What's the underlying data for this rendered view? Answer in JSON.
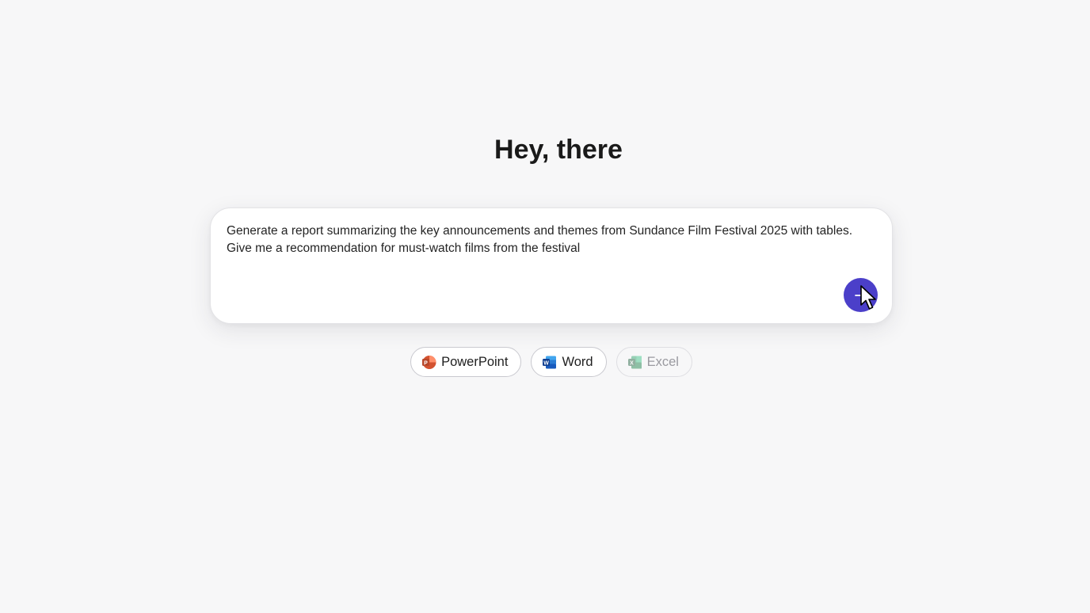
{
  "greeting": "Hey, there",
  "composer": {
    "prompt": "Generate a report summarizing the key announcements and themes from Sundance Film Festival 2025 with tables.\nGive me a recommendation for must-watch films from the festival",
    "send_icon": "arrow-right-icon"
  },
  "chips": [
    {
      "label": "PowerPoint",
      "icon": "powerpoint-icon",
      "color": "#c43e1c",
      "state": "enabled"
    },
    {
      "label": "Word",
      "icon": "word-icon",
      "color": "#185abd",
      "state": "enabled"
    },
    {
      "label": "Excel",
      "icon": "excel-icon",
      "color": "#107c41",
      "state": "disabled"
    }
  ],
  "colors": {
    "background": "#f7f7f8",
    "accent": "#4b3fc9"
  }
}
